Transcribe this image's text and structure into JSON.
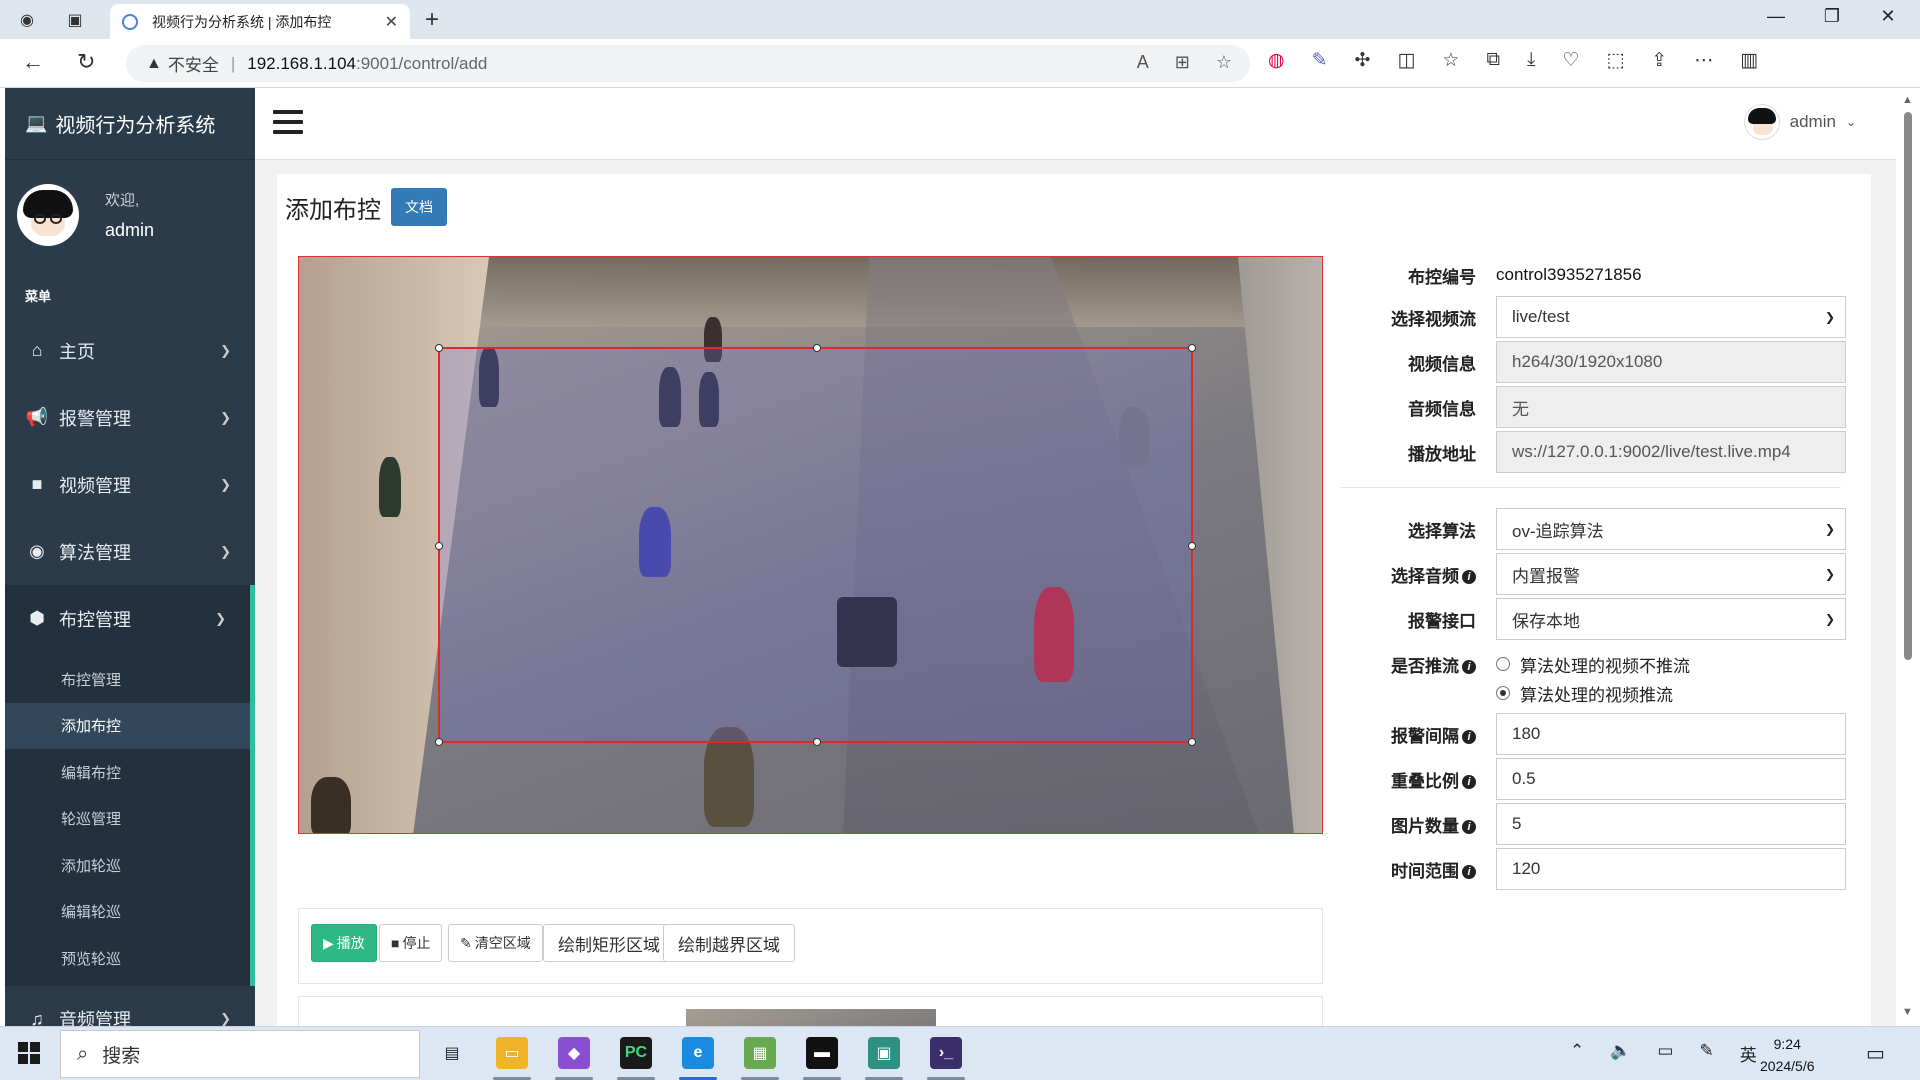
{
  "browser": {
    "tab_title": "视频行为分析系统 | 添加布控",
    "tab_close": "✕",
    "new_tab": "+",
    "security_label": "不安全",
    "url_separator": "|",
    "url_host": "192.168.1.104",
    "url_path": ":9001/control/add"
  },
  "sidebar": {
    "brand": "视频行为分析系统",
    "welcome": "欢迎,",
    "username": "admin",
    "menu_title": "菜单",
    "items": [
      {
        "label": "主页",
        "icon": "home-icon"
      },
      {
        "label": "报警管理",
        "icon": "bullhorn-icon"
      },
      {
        "label": "视频管理",
        "icon": "video-camera-icon"
      },
      {
        "label": "算法管理",
        "icon": "eye-icon"
      },
      {
        "label": "布控管理",
        "icon": "cube-icon"
      }
    ],
    "sub_items": [
      "布控管理",
      "添加布控",
      "编辑布控",
      "轮巡管理",
      "添加轮巡",
      "编辑轮巡",
      "预览轮巡"
    ],
    "after_items": [
      {
        "label": "音频管理",
        "icon": "music-icon"
      }
    ]
  },
  "topnav": {
    "user_label": "admin"
  },
  "page": {
    "title": "添加布控",
    "doc_button": "文档"
  },
  "toolbar": {
    "play": "播放",
    "stop": "停止",
    "clear": "清空区域",
    "draw_rect": "绘制矩形区域",
    "draw_line": "绘制越界区域"
  },
  "form": {
    "code_label": "布控编号",
    "code_value": "control3935271856",
    "stream_label": "选择视频流",
    "stream_value": "live/test",
    "video_info_label": "视频信息",
    "video_info_value": "h264/30/1920x1080",
    "audio_info_label": "音频信息",
    "audio_info_value": "无",
    "play_url_label": "播放地址",
    "play_url_value": "ws://127.0.0.1:9002/live/test.live.mp4",
    "algo_label": "选择算法",
    "algo_value": "ov-追踪算法",
    "sound_label": "选择音频",
    "sound_value": "内置报警",
    "alarm_api_label": "报警接口",
    "alarm_api_value": "保存本地",
    "push_label": "是否推流",
    "push_options": [
      "算法处理的视频不推流",
      "算法处理的视频推流"
    ],
    "push_selected_index": 1,
    "interval_label": "报警间隔",
    "interval_value": "180",
    "overlap_label": "重叠比例",
    "overlap_value": "0.5",
    "image_count_label": "图片数量",
    "image_count_value": "5",
    "time_range_label": "时间范围",
    "time_range_value": "120"
  },
  "taskbar": {
    "search_placeholder": "搜索",
    "ime": "英",
    "time": "9:24",
    "date": "2024/5/6"
  }
}
